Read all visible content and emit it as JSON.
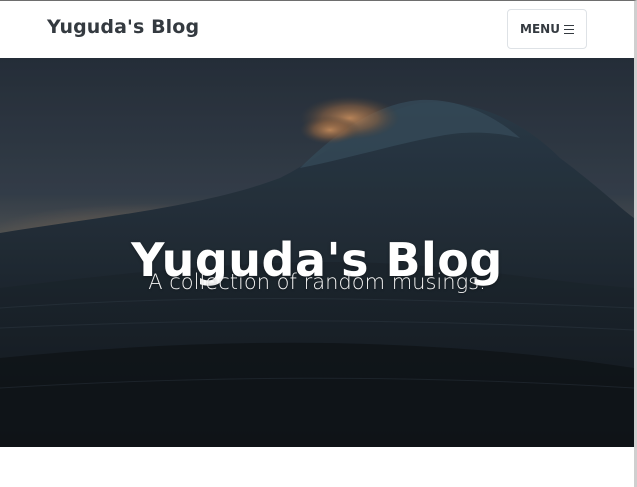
{
  "navbar": {
    "brand": "Yuguda's Blog",
    "menu_label": "MENU",
    "menu_icon": "hamburger-icon"
  },
  "hero": {
    "title": "Yuguda's Blog",
    "subtitle": "A collection of random musings.",
    "background_image": "ocean-wave-at-dusk"
  },
  "colors": {
    "text_dark": "#343a40",
    "hero_text": "#ffffff",
    "button_border": "#dee2e6"
  }
}
